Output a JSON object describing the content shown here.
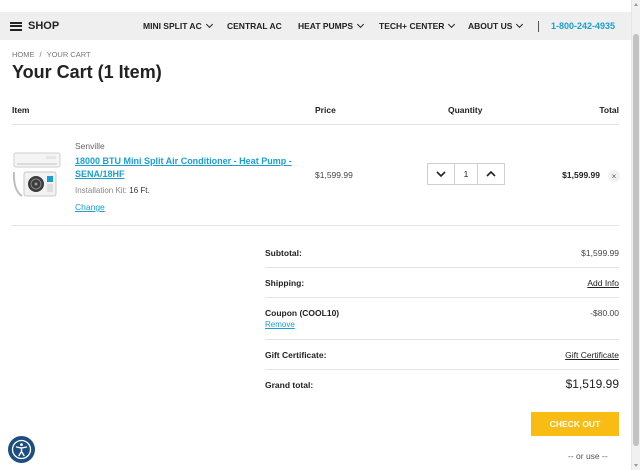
{
  "nav": {
    "shop_label": "SHOP",
    "items": [
      {
        "label": "MINI SPLIT AC",
        "dropdown": true
      },
      {
        "label": "CENTRAL AC",
        "dropdown": false
      },
      {
        "label": "HEAT PUMPS",
        "dropdown": true
      },
      {
        "label": "TECH+ CENTER",
        "dropdown": true
      },
      {
        "label": "ABOUT US",
        "dropdown": true
      }
    ],
    "phone": "1-800-242-4935"
  },
  "breadcrumb": [
    "HOME",
    "YOUR CART"
  ],
  "breadcrumb_separator": "/",
  "page_title": "Your Cart (1 Item)",
  "table_headers": {
    "item": "Item",
    "price": "Price",
    "quantity": "Quantity",
    "total": "Total"
  },
  "cart_item": {
    "brand": "Senville",
    "name": "18000 BTU Mini Split Air Conditioner - Heat Pump - SENA/18HF",
    "option_label": "Installation Kit:",
    "option_value": "16 Ft.",
    "change_label": "Change",
    "price": "$1,599.99",
    "quantity": "1",
    "total": "$1,599.99",
    "remove_symbol": "×"
  },
  "summary": {
    "subtotal_label": "Subtotal:",
    "subtotal_value": "$1,599.99",
    "shipping_label": "Shipping:",
    "shipping_link": "Add Info",
    "coupon_label": "Coupon (COOL10)",
    "coupon_remove": "Remove",
    "coupon_value": "-$80.00",
    "gift_label": "Gift Certificate:",
    "gift_link": "Gift Certificate",
    "grand_label": "Grand total:",
    "grand_value": "$1,519.99"
  },
  "checkout_label": "CHECK OUT",
  "or_use": "-- or use --",
  "colors": {
    "accent": "#19a0cf",
    "checkout": "#f9bc15",
    "nav_bg": "#efefef",
    "accessibility": "#1c4e80"
  },
  "icons": {
    "menu": "hamburger-icon",
    "dropdown": "chevron-down-icon",
    "qty_minus": "chevron-down-icon",
    "qty_plus": "chevron-up-icon",
    "remove": "close-icon",
    "accessibility": "accessibility-icon"
  }
}
